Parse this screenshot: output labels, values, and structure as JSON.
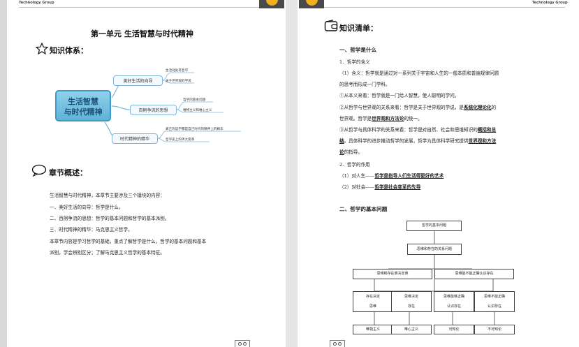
{
  "header": {
    "brand": "Technology Group"
  },
  "left": {
    "title": "第一单元 生活智慧与时代精神",
    "knowledge_system_label": "知识体系：",
    "mindmap": {
      "center": [
        "生活智慧",
        "与时代精神"
      ],
      "branches": [
        {
          "label": "美好生活的向导",
          "leaves": [
            "生活处处有哲学",
            "关于世界观的学说"
          ]
        },
        {
          "label": "百舸争流的思想",
          "leaves": [
            "哲学的基本问题",
            "唯物主义和唯心主义"
          ]
        },
        {
          "label": "时代精神的精华",
          "leaves": [
            "真正的哲学都是自己时代的精神上的精华",
            "哲学史上的伟大变革"
          ]
        }
      ]
    },
    "chapter_overview_label": "章节概述：",
    "overview_lines": [
      "生活智慧与时代精神，本章节主要涉及三个模块的内容：",
      "一、美好生活的向导：哲学是什么。",
      "二、百舸争流的思想：哲学的基本问题和哲学的基本派别。",
      "三、时代精神的精华：马克思主义哲学。",
      "本章节内容是学习哲学的基础，重点了解哲学是什么，哲学的基本问题和基本",
      "派别，学会辨别区分；了解马克思主义哲学的基本特征。"
    ]
  },
  "right": {
    "checklist_label": "知识清单：",
    "sec1_title": "一、哲学是什么",
    "l1": "1．哲学的含义",
    "l2": "（1）含义：哲学就是通过对一系列关于宇宙和人生的一般本质和普遍规律问题",
    "l3": "的思考而形成一门学科。",
    "l4": "①从本义来看：哲学就是一门给人智慧，使人聪明的学问。",
    "l5a": "②从哲学与世界观的关系来看：哲学是关于世界观的学说，是",
    "l5b": "系统化理论化",
    "l5c": "的",
    "l6a": "世界观。哲学是",
    "l6b": "世界观和方法论",
    "l6c": "的统一。",
    "l7a": "③从哲学与具体科学的关系来看：哲学是对自然、社会和思维知识的",
    "l7b": "概括和总",
    "l8a": "结",
    "l8b": "。具体科学的进步推动哲学的发展，哲学为具体科学研究提供",
    "l8c": "世界观和方法",
    "l9a": "论",
    "l9b": "的指导。",
    "l10": "2．哲学的作用",
    "l11a": "（1）对人生——",
    "l11b": "哲学是指导人们生活得更好的艺术",
    "l12a": "（2）对社会——",
    "l12b": "哲学是社会变革的先导",
    "sec2_title": "二、哲学的基本问题",
    "flow": {
      "root": "哲学的基本问题",
      "level2": "思维和存在的关系问题",
      "level3": [
        "思维和存在谁决定谁",
        "思维能不能正确认识存在"
      ],
      "level4": [
        [
          "存在决定",
          "思维"
        ],
        [
          "思维决定",
          "存在"
        ],
        [
          "思维能够正确",
          "认识存在"
        ],
        [
          "思维不能正确",
          "认识存在"
        ]
      ],
      "level5": [
        "唯物主义",
        "唯心主义",
        "可知论",
        "不可知论"
      ]
    }
  }
}
